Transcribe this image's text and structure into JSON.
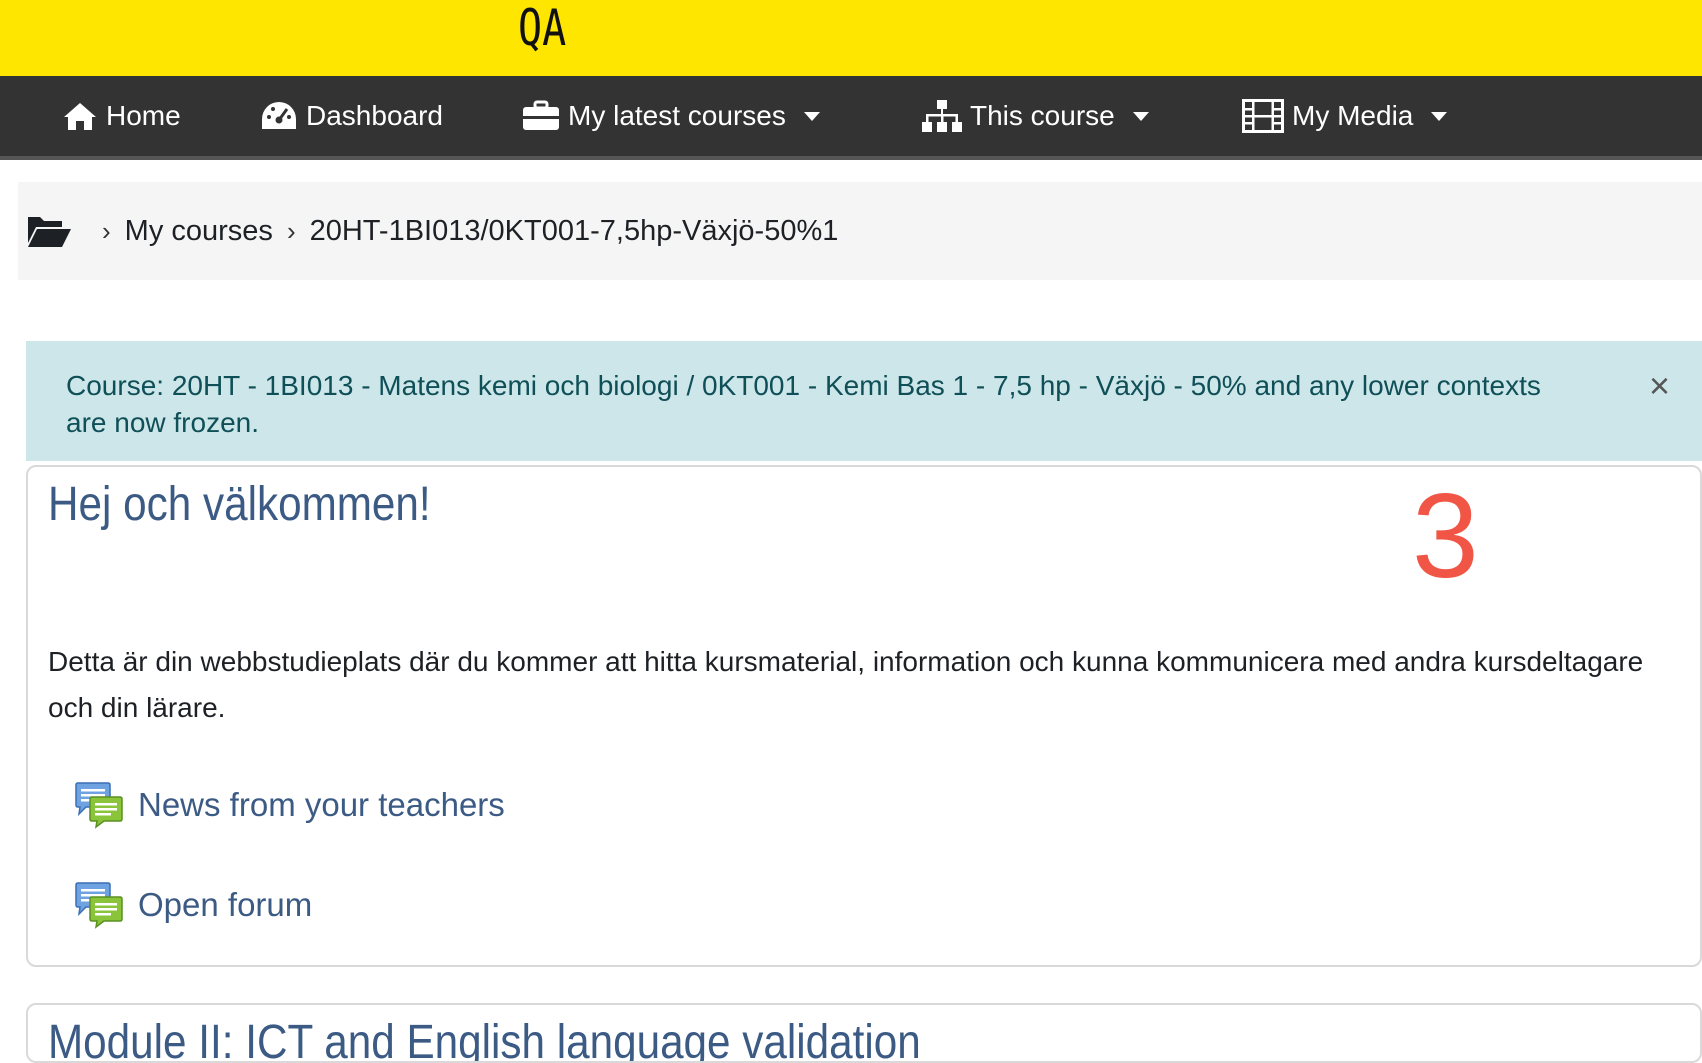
{
  "header": {
    "site_tag": "QA"
  },
  "nav": {
    "items": [
      {
        "label": "Home",
        "icon": "home-icon"
      },
      {
        "label": "Dashboard",
        "icon": "dashboard-icon"
      },
      {
        "label": "My latest courses",
        "icon": "briefcase-icon",
        "dropdown": true
      },
      {
        "label": "This course",
        "icon": "sitemap-icon",
        "dropdown": true
      },
      {
        "label": "My Media",
        "icon": "film-icon",
        "dropdown": true
      }
    ]
  },
  "breadcrumb": {
    "icon": "folder-open-icon",
    "items": [
      "My courses",
      "20HT-1BI013/0KT001-7,5hp-Växjö-50%1"
    ]
  },
  "alert": {
    "text": "Course: 20HT - 1BI013 - Matens kemi och biologi / 0KT001 - Kemi Bas 1 - 7,5 hp - Växjö - 50% and any lower contexts are now frozen.",
    "close": "×"
  },
  "section": {
    "title": "Hej och välkommen!",
    "annotation": "3",
    "description": "Detta är din webbstudieplats där du kommer att hitta kursmaterial, information och kunna kommunicera med andra kursdeltagare och din lärare.",
    "activities": [
      {
        "label": "News from your teachers",
        "icon": "forum-icon"
      },
      {
        "label": "Open forum",
        "icon": "forum-icon"
      }
    ]
  },
  "next_section": {
    "title": "Module II: ICT and English language validation"
  },
  "colors": {
    "topbar": "#ffe600",
    "navbar": "#333333",
    "alert_bg": "#cde6e9",
    "link": "#3b5a84",
    "annotation": "#f05545"
  }
}
